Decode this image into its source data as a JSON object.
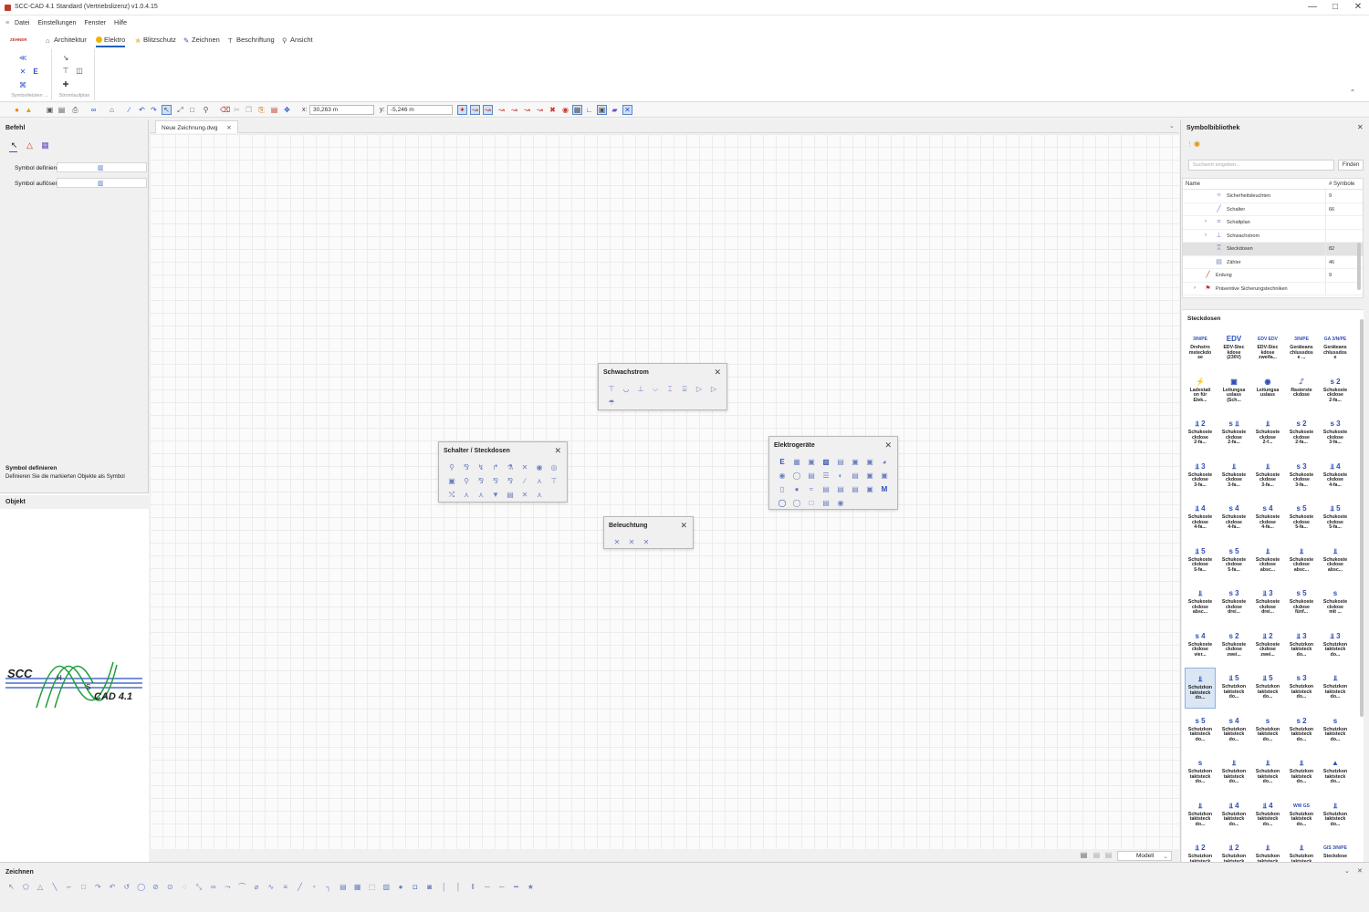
{
  "window": {
    "title": "SCC-CAD 4.1 Standard (Vertriebslizenz) v1.0.4.15",
    "minimize": "—",
    "maximize": "□",
    "close": "✕"
  },
  "menu": [
    "Datei",
    "Einstellungen",
    "Fenster",
    "Hilfe"
  ],
  "brand_tag": "ZEHNER",
  "ribbon_tabs": [
    "Architektur",
    "Elektro",
    "Blitzschutz",
    "Zeichnen",
    "Beschriftung",
    "Ansicht"
  ],
  "active_ribbon_tab": "Elektro",
  "ribbon_groups": [
    "Symbolleisten ...",
    "Stromlaufplan"
  ],
  "coords": {
    "x_label": "x:",
    "x_value": "30,263 m",
    "y_label": "y:",
    "y_value": "-5,246 m"
  },
  "command_panel": {
    "title": "Befehl",
    "fields": [
      {
        "label": "Symbol definieren"
      },
      {
        "label": "Symbol auflösen"
      }
    ],
    "help_title": "Symbol definieren",
    "help_text": "Definieren Sie die markierten Objekte als Symbol"
  },
  "object_panel": {
    "title": "Objekt",
    "logo_scc": "SCC",
    "logo_h": "H",
    "logo_s": "S",
    "logo_cad": "CAD 4.1"
  },
  "document_tab": "Neue Zeichnung.dwg",
  "palettes": [
    {
      "id": "schwachstrom",
      "title": "Schwachstrom"
    },
    {
      "id": "schalter",
      "title": "Schalter / Steckdosen"
    },
    {
      "id": "beleuchtung",
      "title": "Beleuchtung"
    },
    {
      "id": "elektrogeraete",
      "title": "Elektrogeräte"
    }
  ],
  "layout_selector": "Modell",
  "symbol_library": {
    "title": "Symbolbibliothek",
    "search_placeholder": "Suchwort eingeben...",
    "find_button": "Finden",
    "columns": [
      "Name",
      "# Symbole"
    ],
    "tree": [
      {
        "name": "Sicherheitsleuchten",
        "count": "9",
        "indent": 2,
        "expandable": false,
        "selected": false,
        "icon": "emergency-light-icon"
      },
      {
        "name": "Schalter",
        "count": "66",
        "indent": 2,
        "expandable": false,
        "selected": false,
        "icon": "switch-icon"
      },
      {
        "name": "Schaltplan",
        "count": "",
        "indent": 2,
        "expandable": true,
        "selected": false,
        "icon": "circuit-icon"
      },
      {
        "name": "Schwachstrom",
        "count": "",
        "indent": 2,
        "expandable": true,
        "selected": false,
        "icon": "lowvoltage-icon"
      },
      {
        "name": "Steckdosen",
        "count": "82",
        "indent": 2,
        "expandable": false,
        "selected": true,
        "icon": "socket-icon"
      },
      {
        "name": "Zähler",
        "count": "46",
        "indent": 2,
        "expandable": false,
        "selected": false,
        "icon": "meter-icon"
      },
      {
        "name": "Erdung",
        "count": "9",
        "indent": 1,
        "expandable": false,
        "selected": false,
        "icon": "ground-icon"
      },
      {
        "name": "Präventive Sicherungstechniken",
        "count": "",
        "indent": 1,
        "expandable": true,
        "selected": false,
        "icon": "safety-icon"
      }
    ],
    "gallery_title": "Steckdosen",
    "gallery": [
      [
        "3/N/PE",
        "Drehstro\nmsteckdo\nse"
      ],
      [
        "EDV",
        "EDV-Stec\nkdose\n(230V)"
      ],
      [
        "EDV EDV",
        "EDV-Stec\nkdose\nzweifa..."
      ],
      [
        "3/N/PE",
        "Geräteans\nchlussdos\ne ..."
      ],
      [
        "GA 3/N/PE",
        "Geräteans\nchlussdos\ne"
      ],
      [
        "⚡",
        "Ladestati\non für\nElek..."
      ],
      [
        "▣",
        "Leitungsa\nuslass\n(Sch..."
      ],
      [
        "◉",
        "Leitungsa\nuslass"
      ],
      [
        "⑀",
        "Rasierste\nckdose"
      ],
      [
        "s 2",
        "Schukoste\nckdose\n2-fa..."
      ],
      [
        "⫫ 2",
        "Schukoste\nckdose\n2-fa..."
      ],
      [
        "s ⫫",
        "Schukoste\nckdose\n2-fa..."
      ],
      [
        "⫫",
        "Schukoste\nckdose\n2-f..."
      ],
      [
        "s 2",
        "Schukoste\nckdose\n2-fa..."
      ],
      [
        "s 3",
        "Schukoste\nckdose\n3-fa..."
      ],
      [
        "⫫ 3",
        "Schukoste\nckdose\n3-fa..."
      ],
      [
        "⫫",
        "Schukoste\nckdose\n3-fa..."
      ],
      [
        "⫫",
        "Schukoste\nckdose\n3-fa..."
      ],
      [
        "s 3",
        "Schukoste\nckdose\n3-fa..."
      ],
      [
        "⫫ 4",
        "Schukoste\nckdose\n4-fa..."
      ],
      [
        "⫫ 4",
        "Schukoste\nckdose\n4-fa..."
      ],
      [
        "s 4",
        "Schukoste\nckdose\n4-fa..."
      ],
      [
        "s 4",
        "Schukoste\nckdose\n4-fa..."
      ],
      [
        "s 5",
        "Schukoste\nckdose\n5-fa..."
      ],
      [
        "⫫ 5",
        "Schukoste\nckdose\n5-fa..."
      ],
      [
        "⫫ 5",
        "Schukoste\nckdose\n5-fa..."
      ],
      [
        "s 5",
        "Schukoste\nckdose\n5-fa..."
      ],
      [
        "⫫",
        "Schukoste\nckdose\nabsc..."
      ],
      [
        "⫫",
        "Schukoste\nckdose\nabsc..."
      ],
      [
        "⫫",
        "Schukoste\nckdose\nabsc..."
      ],
      [
        "⫫",
        "Schukoste\nckdose\nabsc..."
      ],
      [
        "s 3",
        "Schukoste\nckdose\ndrei..."
      ],
      [
        "⫫ 3",
        "Schukoste\nckdose\ndrei..."
      ],
      [
        "s 5",
        "Schukoste\nckdose\nfünf..."
      ],
      [
        "s",
        "Schukoste\nckdose\nmit ..."
      ],
      [
        "s 4",
        "Schukoste\nckdose\nvier..."
      ],
      [
        "s 2",
        "Schukoste\nckdose\nzwei..."
      ],
      [
        "⫫ 2",
        "Schukoste\nckdose\nzwei..."
      ],
      [
        "⫫ 3",
        "Schutzkon\ntaktsteck\ndo..."
      ],
      [
        "⫫ 3",
        "Schutzkon\ntaktsteck\ndo..."
      ],
      [
        "⫫",
        "Schutzkon\ntaktsteck\ndo..."
      ],
      [
        "⫫ 5",
        "Schutzkon\ntaktsteck\ndo..."
      ],
      [
        "⫫ 5",
        "Schutzkon\ntaktsteck\ndo..."
      ],
      [
        "s 3",
        "Schutzkon\ntaktsteck\ndo..."
      ],
      [
        "⫫",
        "Schutzkon\ntaktsteck\ndo..."
      ],
      [
        "s 5",
        "Schutzkon\ntaktsteck\ndo..."
      ],
      [
        "s 4",
        "Schutzkon\ntaktsteck\ndo..."
      ],
      [
        "s",
        "Schutzkon\ntaktsteck\ndo..."
      ],
      [
        "s 2",
        "Schutzkon\ntaktsteck\ndo..."
      ],
      [
        "s",
        "Schutzkon\ntaktsteck\ndo..."
      ],
      [
        "s",
        "Schutzkon\ntaktsteck\ndo..."
      ],
      [
        "⫫",
        "Schutzkon\ntaktsteck\ndo..."
      ],
      [
        "⫫",
        "Schutzkon\ntaktsteck\ndo..."
      ],
      [
        "⫫",
        "Schutzkon\ntaktsteck\ndo..."
      ],
      [
        "▲",
        "Schutzkon\ntaktsteck\ndo..."
      ],
      [
        "⫫",
        "Schutzkon\ntaktsteck\ndo..."
      ],
      [
        "⫫ 4",
        "Schutzkon\ntaktsteck\ndo..."
      ],
      [
        "⫫ 4",
        "Schutzkon\ntaktsteck\ndo..."
      ],
      [
        "WW GS",
        "Schutzkon\ntaktsteck\ndo..."
      ],
      [
        "⫫",
        "Schutzkon\ntaktsteck\ndo..."
      ],
      [
        "⫫ 2",
        "Schutzkon\ntaktsteck\ndo..."
      ],
      [
        "⫫ 2",
        "Schutzkon\ntaktsteck\ndo..."
      ],
      [
        "⫫",
        "Schutzkon\ntaktsteck\ndo..."
      ],
      [
        "⫫",
        "Schutzkon\ntaktsteck\ndo..."
      ],
      [
        "GIS 3/N/PE",
        "Steckdose\n..."
      ]
    ],
    "selected_gallery_index": 40
  },
  "bottom_panel": {
    "title": "Zeichnen"
  },
  "colors": {
    "accent": "#1f5fbf",
    "symbol": "#2f4fb8",
    "palette_symbol": "#6e7fbf",
    "logo_green": "#1e9e3a",
    "logo_blue": "#2b4fc0"
  }
}
